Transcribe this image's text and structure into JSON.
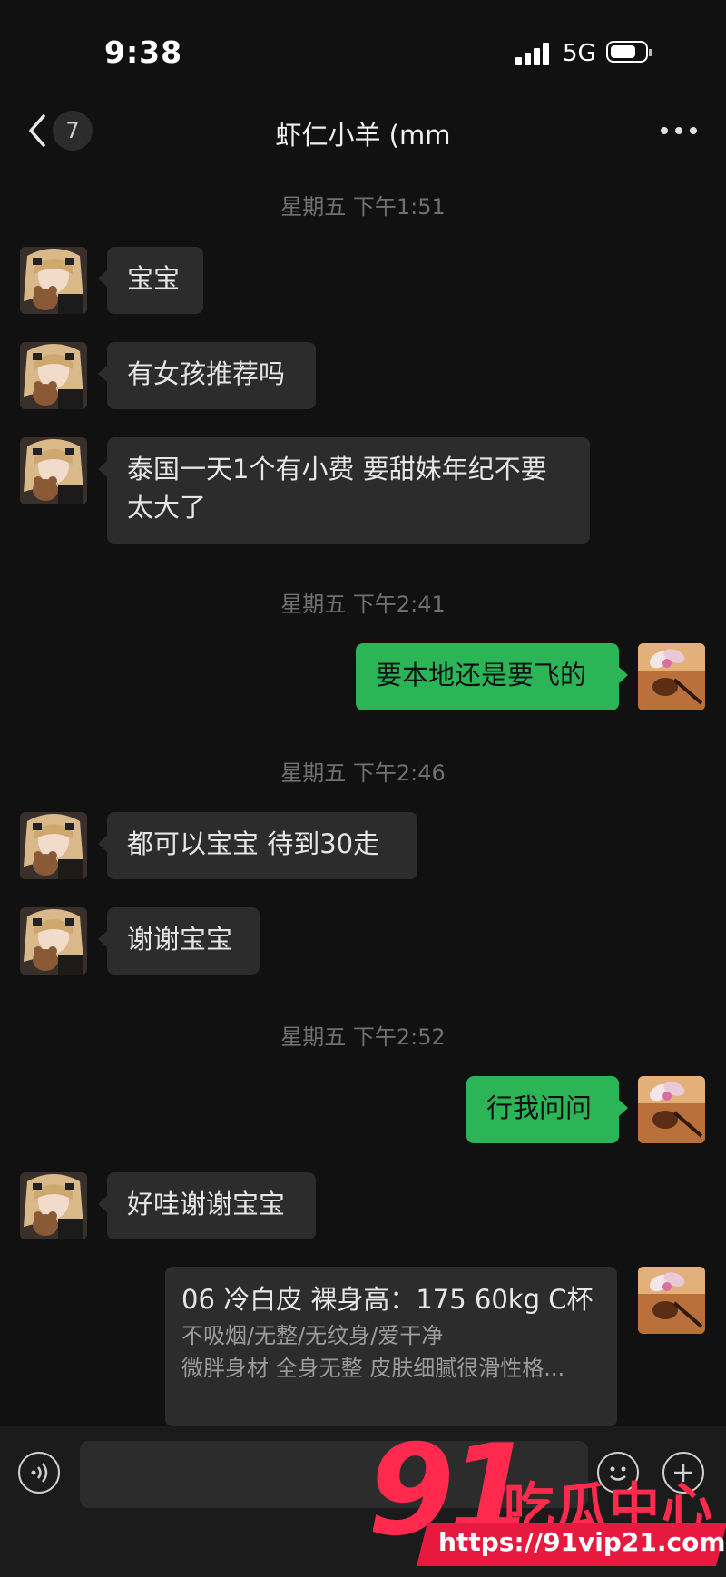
{
  "status_bar": {
    "time": "9:38",
    "network": "5G"
  },
  "nav": {
    "unread_count": "7",
    "title": "虾仁小羊 (mm"
  },
  "timestamps": [
    "星期五 下午1:51",
    "星期五 下午2:41",
    "星期五 下午2:46",
    "星期五 下午2:52"
  ],
  "messages": [
    {
      "side": "in",
      "text": "宝宝"
    },
    {
      "side": "in",
      "text": "有女孩推荐吗"
    },
    {
      "side": "in",
      "text": "泰国一天1个有小费 要甜妹年纪不要太大了"
    },
    {
      "side": "out",
      "text": "要本地还是要飞的"
    },
    {
      "side": "in",
      "text": "都可以宝宝 待到30走"
    },
    {
      "side": "in",
      "text": "谢谢宝宝"
    },
    {
      "side": "out",
      "text": "行我问问"
    },
    {
      "side": "in",
      "text": "好哇谢谢宝宝"
    }
  ],
  "card": {
    "title": "06  冷白皮 裸身高：175  60kg  C杯",
    "line1": "不吸烟/无整/无纹身/爱干净",
    "line2": "微胖身材 全身无整 皮肤细腻很滑性格..."
  },
  "watermark": {
    "number": "91",
    "text": "吃瓜中心",
    "url": "https://91vip21.com"
  },
  "colors": {
    "background": "#111111",
    "incoming_bubble": "#2c2c2c",
    "outgoing_bubble": "#2bb557",
    "watermark_red": "#ff2a4d"
  }
}
